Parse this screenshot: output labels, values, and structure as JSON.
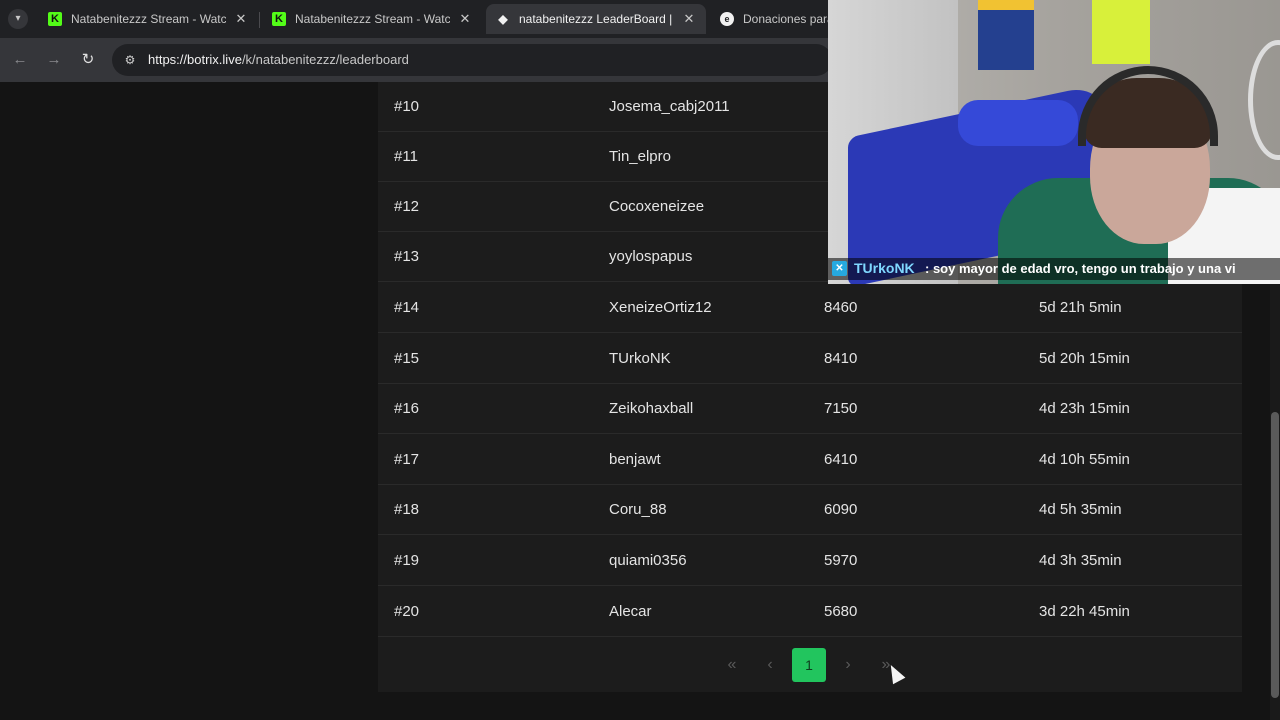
{
  "browser": {
    "tabs": [
      {
        "title": "Natabenitezzz Stream - Watch Live",
        "favicon": "kick-icon",
        "active": false
      },
      {
        "title": "Natabenitezzz Stream - Watch Live",
        "favicon": "kick-icon",
        "active": false
      },
      {
        "title": "natabenitezzz LeaderBoard | The",
        "favicon": "diamond-icon",
        "active": true
      },
      {
        "title": "Donaciones para natabenitezzz",
        "favicon": "e-icon",
        "active": false
      }
    ],
    "url_host": "https://botrix.live",
    "url_path": "/k/natabenitezzz/leaderboard"
  },
  "leaderboard": {
    "rows": [
      {
        "rank": "#10",
        "user": "Josema_cabj2011",
        "points": "",
        "time": ""
      },
      {
        "rank": "#11",
        "user": "Tin_elpro",
        "points": "",
        "time": ""
      },
      {
        "rank": "#12",
        "user": "Cocoxeneizee",
        "points": "",
        "time": ""
      },
      {
        "rank": "#13",
        "user": "yoylospapus",
        "points": "",
        "time": ""
      },
      {
        "rank": "#14",
        "user": "XeneizeOrtiz12",
        "points": "8460",
        "time": "5d 21h 5min"
      },
      {
        "rank": "#15",
        "user": "TUrkoNK",
        "points": "8410",
        "time": "5d 20h 15min"
      },
      {
        "rank": "#16",
        "user": "Zeikohaxball",
        "points": "7150",
        "time": "4d 23h 15min"
      },
      {
        "rank": "#17",
        "user": "benjawt",
        "points": "6410",
        "time": "4d 10h 55min"
      },
      {
        "rank": "#18",
        "user": "Coru_88",
        "points": "6090",
        "time": "4d 5h 35min"
      },
      {
        "rank": "#19",
        "user": "quiami0356",
        "points": "5970",
        "time": "4d 3h 35min"
      },
      {
        "rank": "#20",
        "user": "Alecar",
        "points": "5680",
        "time": "3d 22h 45min"
      }
    ],
    "pagination": {
      "first": "«",
      "prev": "‹",
      "current_page": "1",
      "next": "›",
      "last": "»"
    }
  },
  "overlay": {
    "chat_user": "TUrkoNK",
    "chat_message": ": soy mayor de edad vro, tengo un trabajo y una vi"
  },
  "colors": {
    "accent": "#22c55e",
    "page_bg": "#141414",
    "table_bg": "#1c1c1c"
  }
}
